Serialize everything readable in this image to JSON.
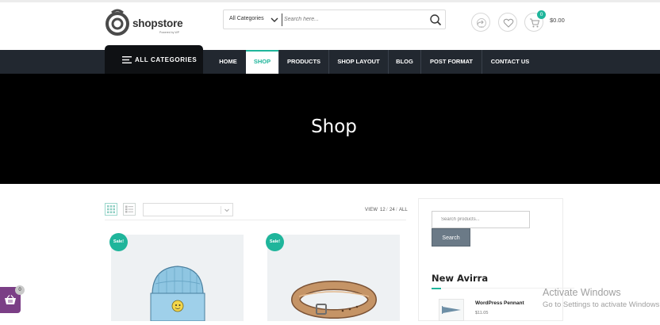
{
  "header": {
    "logo_text": "shopstore",
    "logo_tagline": "Powered by WP",
    "search": {
      "category_label": "All Categories",
      "placeholder": "Search here..."
    },
    "cart": {
      "count": "0",
      "total": "$0.00"
    }
  },
  "nav": {
    "all_categories_label": "ALL CATEGORIES",
    "items": [
      {
        "label": "HOME"
      },
      {
        "label": "SHOP"
      },
      {
        "label": "PRODUCTS"
      },
      {
        "label": "SHOP LAYOUT"
      },
      {
        "label": "BLOG"
      },
      {
        "label": "POST FORMAT"
      },
      {
        "label": "CONTACT US"
      }
    ],
    "active_index": 1
  },
  "hero": {
    "title": "Shop"
  },
  "toolbar": {
    "view_label": "VIEW",
    "view_options": [
      "12",
      "24",
      "ALL"
    ],
    "sort_value": ""
  },
  "products": [
    {
      "badge": "Sale!",
      "icon": "beanie-hat-image"
    },
    {
      "badge": "Sale!",
      "icon": "leather-belt-image"
    }
  ],
  "sidebar": {
    "search_placeholder": "Search products...",
    "search_button": "Search",
    "heading": "New Avirra",
    "items": [
      {
        "name": "WordPress Pennant",
        "price": "$11.05",
        "icon": "pennant-image"
      }
    ]
  },
  "floating_cart": {
    "count": "0"
  },
  "watermark": {
    "title": "Activate Windows",
    "subtitle": "Go to Settings to activate Windows."
  },
  "colors": {
    "accent": "#1fb59b",
    "nav_bg": "#222830",
    "hero_bg": "#000000",
    "floating_cart_bg": "#7b3f86"
  }
}
